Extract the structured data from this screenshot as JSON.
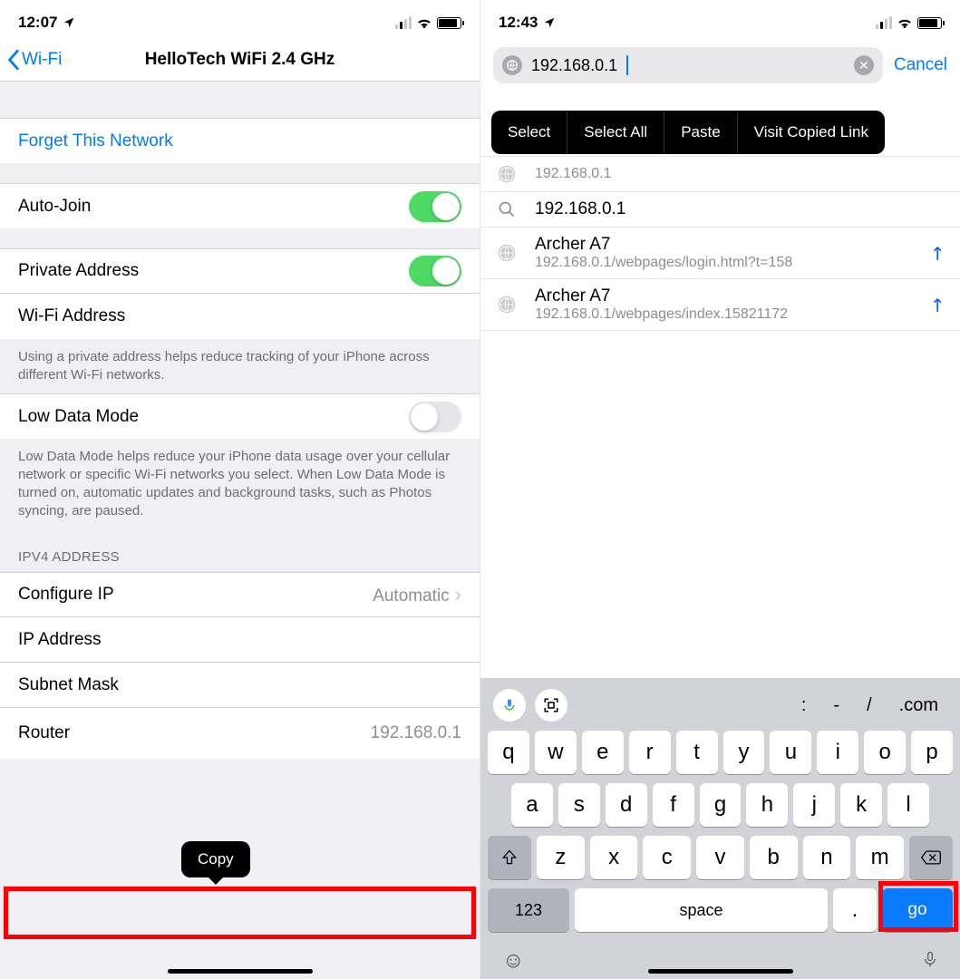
{
  "left": {
    "status_time": "12:07",
    "nav_back": "Wi-Fi",
    "nav_title": "HelloTech WiFi 2.4 GHz",
    "forget": "Forget This Network",
    "auto_join": "Auto-Join",
    "private_addr": "Private Address",
    "wifi_addr": "Wi-Fi Address",
    "private_footer": "Using a private address helps reduce tracking of your iPhone across different Wi-Fi networks.",
    "low_data": "Low Data Mode",
    "low_data_footer": "Low Data Mode helps reduce your iPhone data usage over your cellular network or specific Wi-Fi networks you select. When Low Data Mode is turned on, automatic updates and background tasks, such as Photos syncing, are paused.",
    "ipv4_header": "IPV4 ADDRESS",
    "configure_ip": "Configure IP",
    "configure_ip_val": "Automatic",
    "ip_address": "IP Address",
    "subnet_mask": "Subnet Mask",
    "router_label": "Router",
    "router_value": "192.168.0.1",
    "copy_tooltip": "Copy"
  },
  "right": {
    "status_time": "12:43",
    "search_value": "192.168.0.1",
    "cancel": "Cancel",
    "ctx": {
      "select": "Select",
      "select_all": "Select All",
      "paste": "Paste",
      "visit": "Visit Copied Link"
    },
    "suggestions": [
      {
        "type": "globe",
        "title": "192.168.0.1",
        "sub": ""
      },
      {
        "type": "search",
        "title": "192.168.0.1",
        "sub": ""
      },
      {
        "type": "globe",
        "title": "Archer A7",
        "sub": "192.168.0.1/webpages/login.html?t=158"
      },
      {
        "type": "globe",
        "title": "Archer A7",
        "sub": "192.168.0.1/webpages/index.15821172"
      }
    ],
    "acc_punct": {
      "colon": ":",
      "dash": "-",
      "slash": "/",
      "dotcom": ".com"
    },
    "keys_row1": [
      "q",
      "w",
      "e",
      "r",
      "t",
      "y",
      "u",
      "i",
      "o",
      "p"
    ],
    "keys_row2": [
      "a",
      "s",
      "d",
      "f",
      "g",
      "h",
      "j",
      "k",
      "l"
    ],
    "keys_row3": [
      "z",
      "x",
      "c",
      "v",
      "b",
      "n",
      "m"
    ],
    "key_123": "123",
    "key_space": "space",
    "key_dot": ".",
    "key_go": "go"
  }
}
